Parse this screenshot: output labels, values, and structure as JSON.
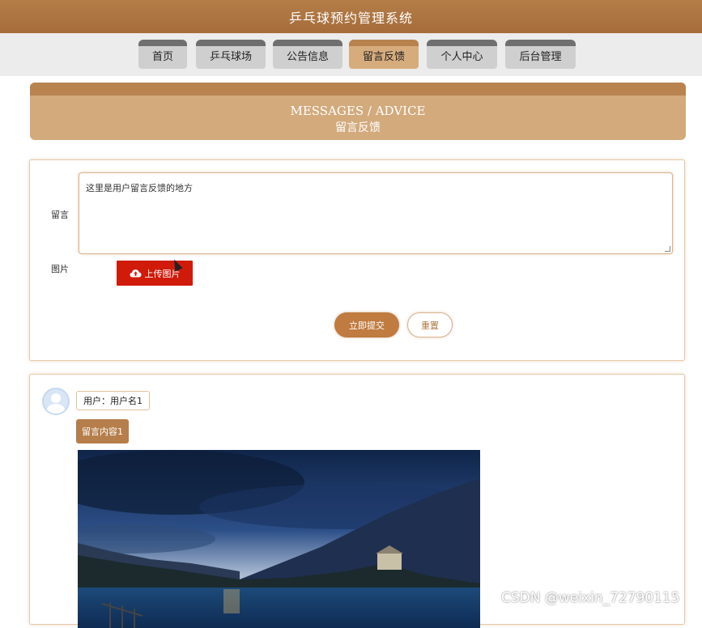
{
  "header": {
    "title": "乒乓球预约管理系统"
  },
  "nav": {
    "items": [
      {
        "label": "首页",
        "active": false
      },
      {
        "label": "乒乓球场",
        "active": false
      },
      {
        "label": "公告信息",
        "active": false
      },
      {
        "label": "留言反馈",
        "active": true
      },
      {
        "label": "个人中心",
        "active": false
      },
      {
        "label": "后台管理",
        "active": false
      }
    ]
  },
  "banner": {
    "en": "MESSAGES / ADVICE",
    "cn": "留言反馈"
  },
  "form": {
    "message_label": "留言",
    "message_value": "这里是用户留言反馈的地方",
    "image_label": "图片",
    "upload_label": "上传图片",
    "submit_label": "立即提交",
    "reset_label": "重置"
  },
  "messages": [
    {
      "user": "用户：用户名1",
      "content": "留言内容1"
    }
  ],
  "watermark": "CSDN @weixin_72790115",
  "colors": {
    "brand": "#a66d3a",
    "active_tab": "#d7ac7d",
    "upload": "#d01a0a",
    "submit": "#c07b40"
  }
}
